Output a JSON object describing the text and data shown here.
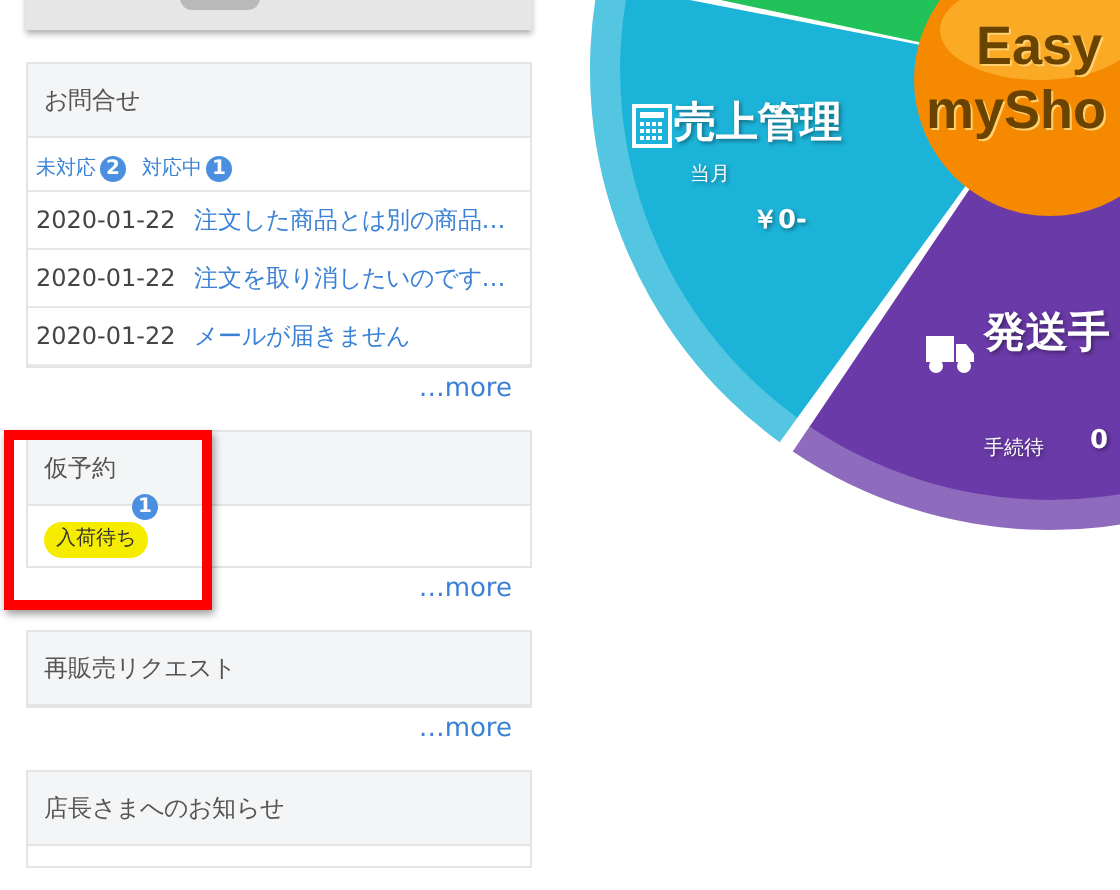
{
  "inquiries": {
    "title": "お問合せ",
    "status_tags": [
      {
        "label": "未対応",
        "count": "2"
      },
      {
        "label": "対応中",
        "count": "1"
      }
    ],
    "rows": [
      {
        "date": "2020-01-22",
        "subject": "注文した商品とは別の商品…"
      },
      {
        "date": "2020-01-22",
        "subject": "注文を取り消したいのです…"
      },
      {
        "date": "2020-01-22",
        "subject": "メールが届きません"
      }
    ],
    "more": "…more"
  },
  "provisional": {
    "title": "仮予約",
    "tags": [
      {
        "label": "入荷待ち",
        "count": "1"
      }
    ],
    "more": "…more",
    "highlighted": true
  },
  "resale": {
    "title": "再販売リクエスト",
    "more": "…more"
  },
  "notice": {
    "title": "店長さまへのお知らせ"
  },
  "wheel": {
    "logo_lines": [
      "Easy",
      "mySho"
    ],
    "segments": [
      {
        "kind": "sales",
        "title": "売上管理",
        "label": "当月",
        "value": "￥0-"
      },
      {
        "kind": "shipping",
        "title": "発送手",
        "label": "手続待",
        "value": "0"
      }
    ]
  }
}
